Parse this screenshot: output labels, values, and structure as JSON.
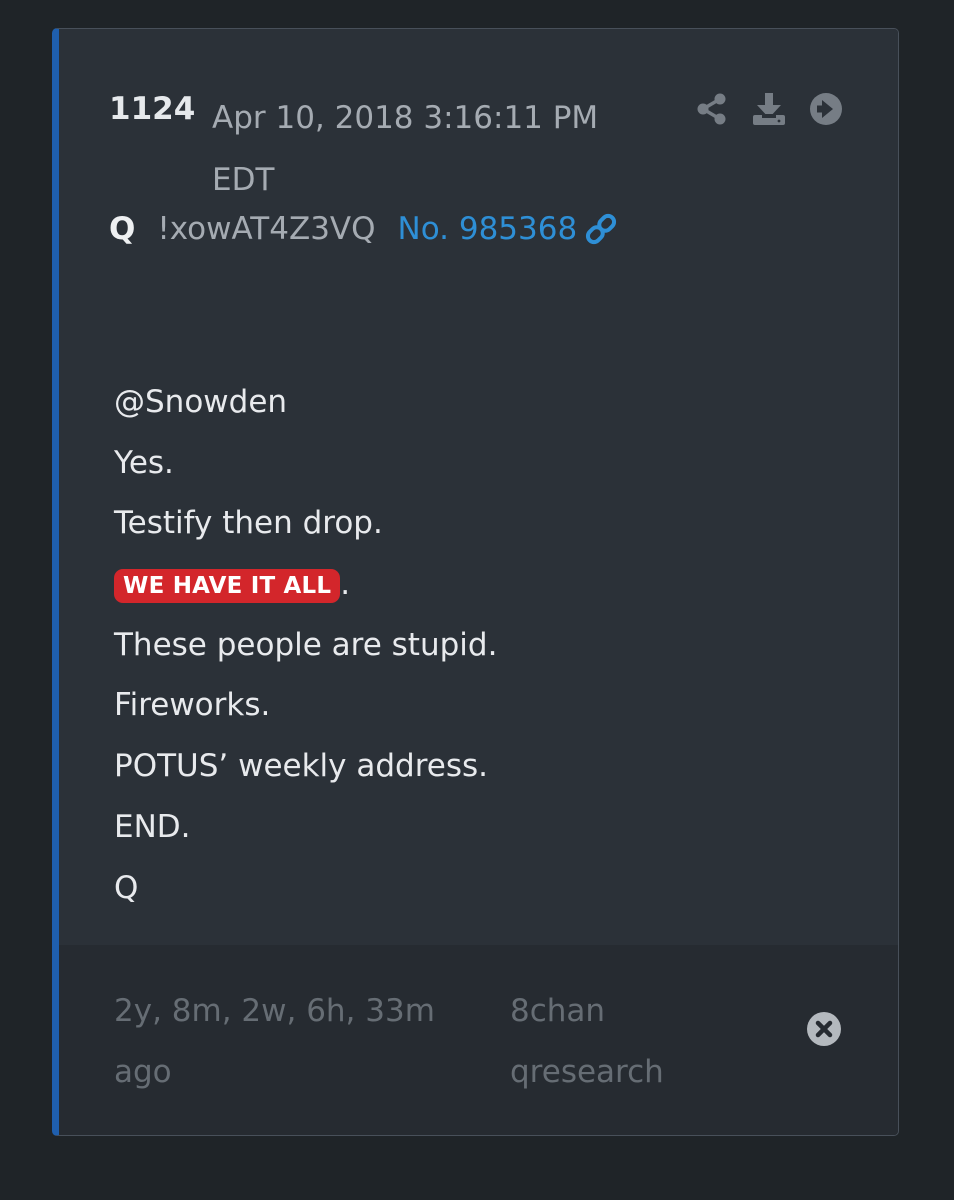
{
  "post": {
    "number": "1124",
    "timestamp": "Apr 10, 2018 3:16:11 PM EDT",
    "author": "Q",
    "tripcode": "!xowAT4Z3VQ",
    "post_link": "No. 985368"
  },
  "actions": {
    "share_icon": "share-icon",
    "download_icon": "download-icon",
    "open_icon": "arrow-right-circle-icon"
  },
  "body": {
    "line1": "@Snowden",
    "line2": "Yes.",
    "line3": "Testify then drop.",
    "highlight": "WE HAVE IT ALL",
    "highlight_suffix": ".",
    "line5": "These people are stupid.",
    "line6": "Fireworks.",
    "line7": "POTUS’ weekly address.",
    "line8": "END.",
    "line9": "Q"
  },
  "footer": {
    "elapsed": "2y, 8m, 2w, 6h, 33m ago",
    "source": "8chan qresearch"
  },
  "colors": {
    "accent_border": "#1f5fae",
    "link": "#2e8fd6",
    "highlight_bg": "#d3262b"
  }
}
